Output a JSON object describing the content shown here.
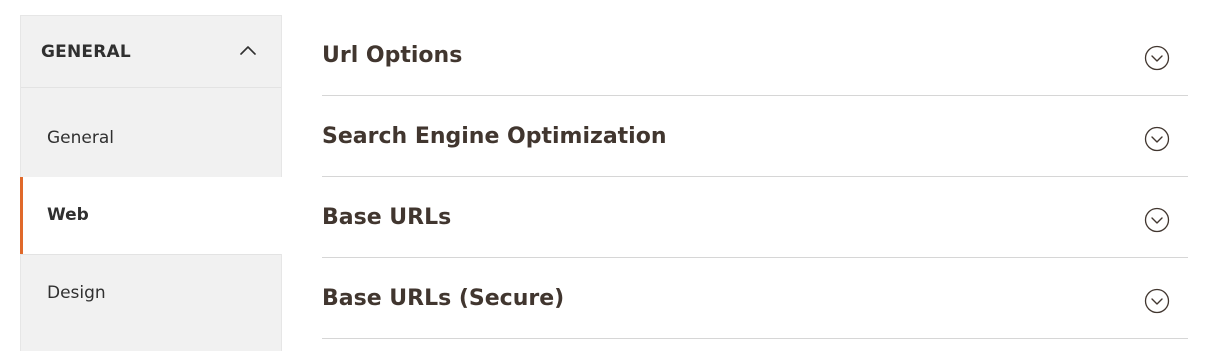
{
  "sidebar": {
    "header": {
      "title": "GENERAL",
      "icon": "chevron-up-icon"
    },
    "items": [
      {
        "label": "General",
        "active": false
      },
      {
        "label": "Web",
        "active": true
      },
      {
        "label": "Design",
        "active": false
      }
    ],
    "active_accent_color": "#e0692a"
  },
  "main": {
    "sections": [
      {
        "title": "Url Options",
        "icon": "expand-circle-icon"
      },
      {
        "title": "Search Engine Optimization",
        "icon": "expand-circle-icon"
      },
      {
        "title": "Base URLs",
        "icon": "expand-circle-icon"
      },
      {
        "title": "Base URLs (Secure)",
        "icon": "expand-circle-icon"
      }
    ]
  }
}
